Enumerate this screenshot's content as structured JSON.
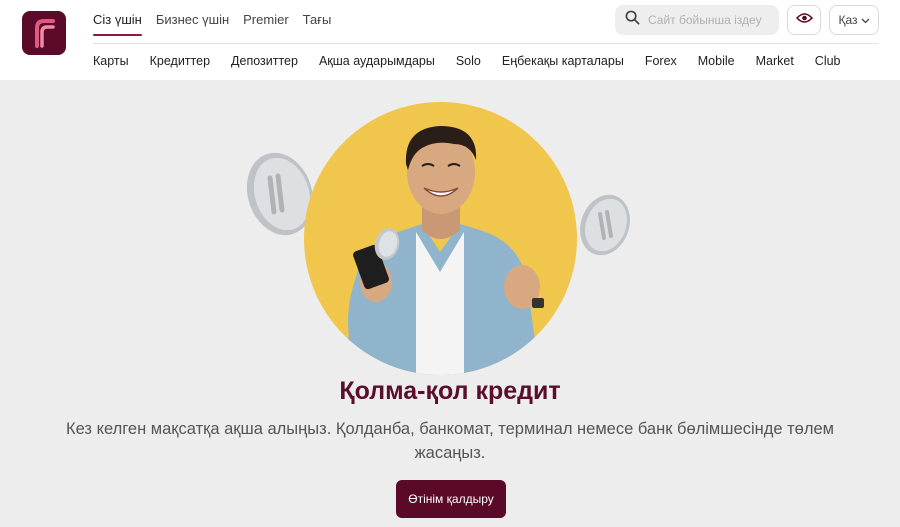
{
  "colors": {
    "brand": "#5a0a28",
    "accent": "#8a1a45",
    "hero_circle": "#f0c64c",
    "background": "#ededed"
  },
  "header": {
    "top_tabs": [
      {
        "label": "Сіз үшін",
        "active": true
      },
      {
        "label": "Бизнес үшін",
        "active": false
      },
      {
        "label": "Premier",
        "active": false
      },
      {
        "label": "Тағы",
        "active": false
      }
    ],
    "search": {
      "placeholder": "Сайт бойынша іздеу",
      "icon": "search-icon"
    },
    "accessibility_icon": "eye-icon",
    "language": "Қаз",
    "sub_nav": [
      "Карты",
      "Кредиттер",
      "Депозиттер",
      "Ақша аударымдары",
      "Solo",
      "Еңбекақы карталары",
      "Forex",
      "Mobile",
      "Market",
      "Club"
    ]
  },
  "hero": {
    "title": "Қолма-қол кредит",
    "subtitle": "Кез келген мақсатқа ақша алыңыз. Қолданба, банкомат, терминал немесе банк бөлімшесінде төлем жасаңыз.",
    "cta_label": "Өтінім қалдыру"
  }
}
